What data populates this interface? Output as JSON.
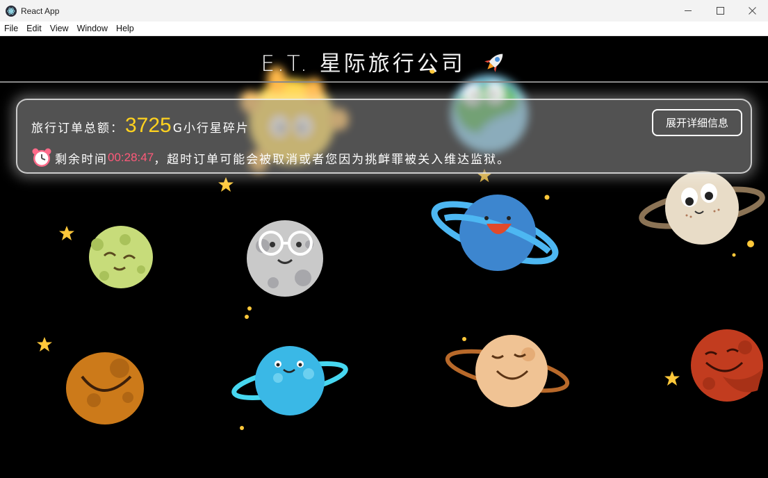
{
  "window": {
    "title": "React App",
    "minimize": "—",
    "maximize": "☐",
    "close": "✕"
  },
  "menu": [
    "File",
    "Edit",
    "View",
    "Window",
    "Help"
  ],
  "page": {
    "title": "E.T. 星际旅行公司",
    "title_icon": "rocket-icon"
  },
  "order": {
    "label": "旅行订单总额：",
    "amount": "3725",
    "unit": "G小行星碎片",
    "clock_icon": "alarm-clock-icon",
    "time_label": "剩余时间",
    "time_left": "00:28:47",
    "warning": "，超时订单可能会被取消或者您因为挑衅罪被关入维达监狱。",
    "detail_button": "展开详细信息"
  },
  "colors": {
    "amount": "#ffd21f",
    "timer": "#ff5a7a",
    "background": "#000000"
  },
  "decorations": [
    "sun-planet",
    "earth-planet",
    "green-planet",
    "moon-planet",
    "blue-ringed-planet",
    "beige-ringed-planet",
    "orange-planet",
    "cyan-ringed-planet",
    "peach-ringed-planet",
    "red-planet",
    "star-icon"
  ]
}
